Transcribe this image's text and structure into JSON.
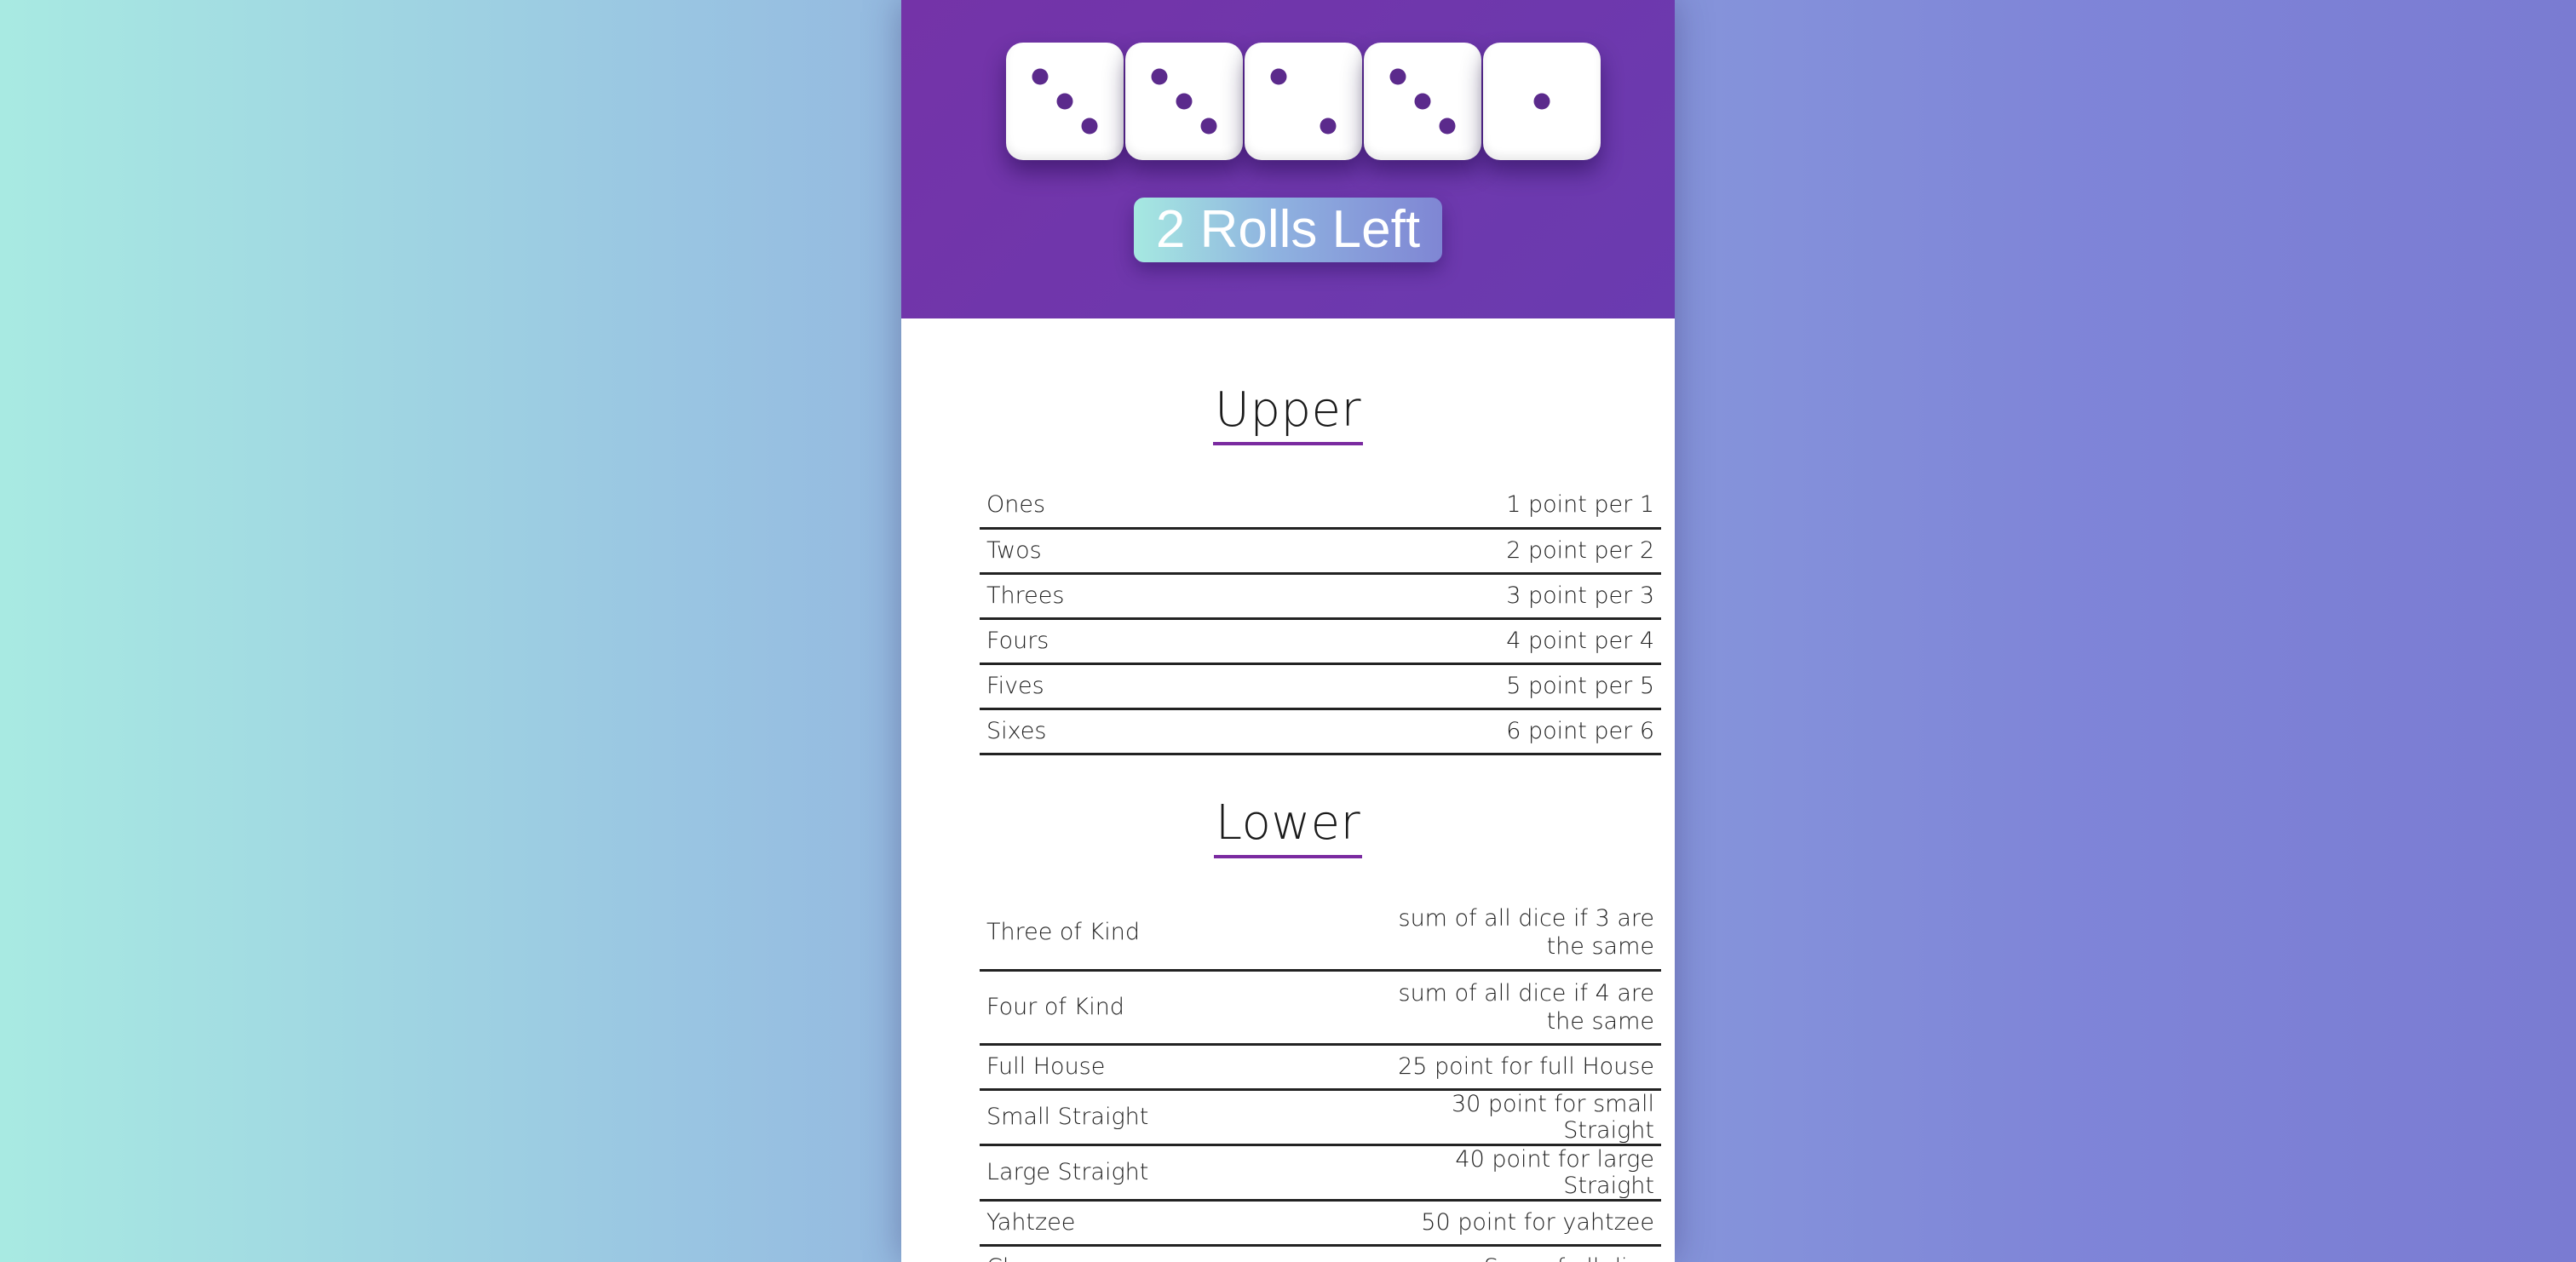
{
  "dice": [
    3,
    3,
    2,
    3,
    1
  ],
  "dice_color": "#5b2a8c",
  "header_color": "#6f37ad",
  "accent_underline": "#7a2aa0",
  "roll_button_label": "2 Rolls Left",
  "upper": {
    "title": "Upper",
    "rows": [
      {
        "name": "Ones",
        "desc": "1 point per 1"
      },
      {
        "name": "Twos",
        "desc": "2 point per 2"
      },
      {
        "name": "Threes",
        "desc": "3 point per 3"
      },
      {
        "name": "Fours",
        "desc": "4 point per 4"
      },
      {
        "name": "Fives",
        "desc": "5 point per 5"
      },
      {
        "name": "Sixes",
        "desc": "6 point per 6"
      }
    ]
  },
  "lower": {
    "title": "Lower",
    "rows": [
      {
        "name": "Three of Kind",
        "desc": "sum of all dice if 3 are the same"
      },
      {
        "name": "Four of Kind",
        "desc": "sum of all dice if 4 are the same"
      },
      {
        "name": "Full House",
        "desc": "25 point for full House"
      },
      {
        "name": "Small Straight",
        "desc": "30 point for small Straight"
      },
      {
        "name": "Large Straight",
        "desc": "40 point for large Straight"
      },
      {
        "name": "Yahtzee",
        "desc": "50 point for yahtzee"
      },
      {
        "name": "Chance",
        "desc": "Sum of all dice"
      }
    ]
  }
}
